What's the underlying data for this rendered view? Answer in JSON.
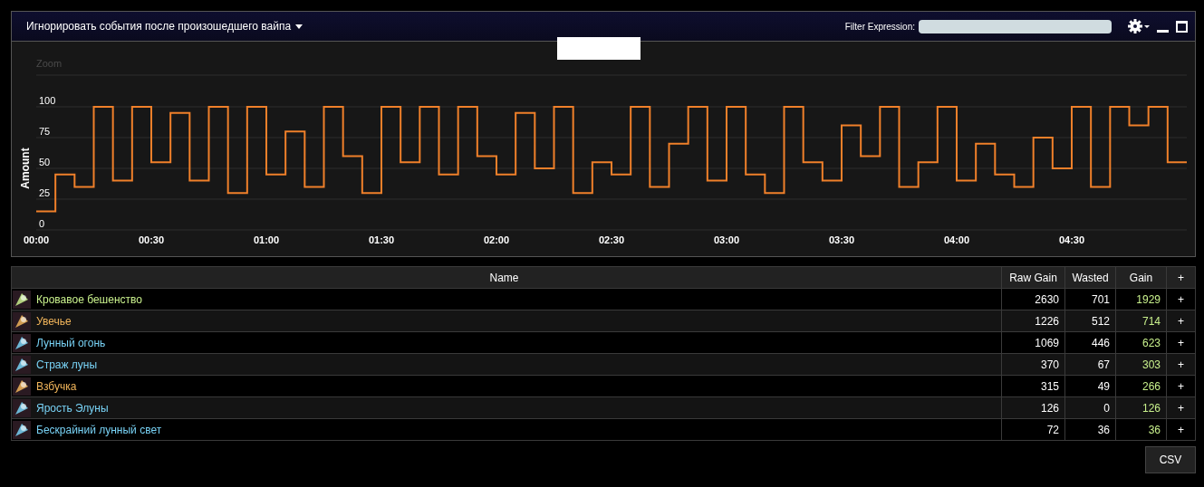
{
  "panel": {
    "title": "Игнорировать события после произошедшего вайпа",
    "filter_label": "Filter Expression:"
  },
  "chart": {
    "zoom_label": "Zoom",
    "chart_data": {
      "type": "line",
      "ylabel": "Amount",
      "grid": true,
      "xlim": [
        0,
        300
      ],
      "ylim": [
        0,
        100
      ],
      "yticks": [
        0,
        25,
        50,
        75,
        100
      ],
      "xticks": [
        {
          "value": 0,
          "label": "00:00"
        },
        {
          "value": 30,
          "label": "00:30"
        },
        {
          "value": 60,
          "label": "01:00"
        },
        {
          "value": 90,
          "label": "01:30"
        },
        {
          "value": 120,
          "label": "02:00"
        },
        {
          "value": 150,
          "label": "02:30"
        },
        {
          "value": 180,
          "label": "03:00"
        },
        {
          "value": 210,
          "label": "03:30"
        },
        {
          "value": 240,
          "label": "04:00"
        },
        {
          "value": 270,
          "label": "04:30"
        }
      ],
      "x": [
        0,
        5,
        5,
        10,
        10,
        15,
        15,
        20,
        20,
        25,
        25,
        30,
        30,
        35,
        35,
        40,
        40,
        45,
        45,
        50,
        50,
        55,
        55,
        60,
        60,
        65,
        65,
        70,
        70,
        75,
        75,
        80,
        80,
        85,
        85,
        90,
        90,
        95,
        95,
        100,
        100,
        105,
        105,
        110,
        110,
        115,
        115,
        120,
        120,
        125,
        125,
        130,
        130,
        135,
        135,
        140,
        140,
        145,
        145,
        150,
        150,
        155,
        155,
        160,
        160,
        165,
        165,
        170,
        170,
        175,
        175,
        180,
        180,
        185,
        185,
        190,
        190,
        195,
        195,
        200,
        200,
        205,
        205,
        210,
        210,
        215,
        215,
        220,
        220,
        225,
        225,
        230,
        230,
        235,
        235,
        240,
        240,
        245,
        245,
        250,
        250,
        255,
        255,
        260,
        260,
        265,
        265,
        270,
        270,
        275,
        275,
        280,
        280,
        285,
        285,
        290,
        290,
        295,
        295,
        300
      ],
      "series": [
        {
          "color": "#f0802a",
          "values": [
            15,
            15,
            45,
            45,
            35,
            35,
            100,
            100,
            40,
            40,
            100,
            100,
            55,
            55,
            95,
            95,
            40,
            40,
            100,
            100,
            30,
            30,
            100,
            100,
            45,
            45,
            80,
            80,
            35,
            35,
            100,
            100,
            60,
            60,
            30,
            30,
            100,
            100,
            55,
            55,
            100,
            100,
            45,
            45,
            100,
            100,
            60,
            60,
            45,
            45,
            95,
            95,
            50,
            50,
            100,
            100,
            30,
            30,
            55,
            55,
            45,
            45,
            100,
            100,
            35,
            35,
            70,
            70,
            100,
            100,
            40,
            40,
            100,
            100,
            45,
            45,
            30,
            30,
            100,
            100,
            55,
            55,
            40,
            40,
            85,
            85,
            60,
            60,
            100,
            100,
            35,
            35,
            55,
            55,
            100,
            100,
            40,
            40,
            70,
            70,
            45,
            45,
            35,
            35,
            75,
            75,
            50,
            50,
            100,
            100,
            35,
            35,
            100,
            100,
            85,
            85,
            100,
            100,
            55,
            55
          ]
        }
      ]
    }
  },
  "table": {
    "columns": [
      "Name",
      "Raw Gain",
      "Wasted",
      "Gain",
      "+"
    ],
    "rows": [
      {
        "name": "Кровавое бешенство",
        "color": "#c8f08c",
        "raw_gain": "2630",
        "wasted": "701",
        "gain": "1929",
        "add": "+"
      },
      {
        "name": "Увечье",
        "color": "#f0b45a",
        "raw_gain": "1226",
        "wasted": "512",
        "gain": "714",
        "add": "+"
      },
      {
        "name": "Лунный огонь",
        "color": "#78d2f5",
        "raw_gain": "1069",
        "wasted": "446",
        "gain": "623",
        "add": "+"
      },
      {
        "name": "Страж луны",
        "color": "#78d2f5",
        "raw_gain": "370",
        "wasted": "67",
        "gain": "303",
        "add": "+"
      },
      {
        "name": "Взбучка",
        "color": "#f0b45a",
        "raw_gain": "315",
        "wasted": "49",
        "gain": "266",
        "add": "+"
      },
      {
        "name": "Ярость Элуны",
        "color": "#78d2f5",
        "raw_gain": "126",
        "wasted": "0",
        "gain": "126",
        "add": "+"
      },
      {
        "name": "Бескрайний лунный свет",
        "color": "#78d2f5",
        "raw_gain": "72",
        "wasted": "36",
        "gain": "36",
        "add": "+"
      }
    ]
  },
  "csv_button": "CSV"
}
